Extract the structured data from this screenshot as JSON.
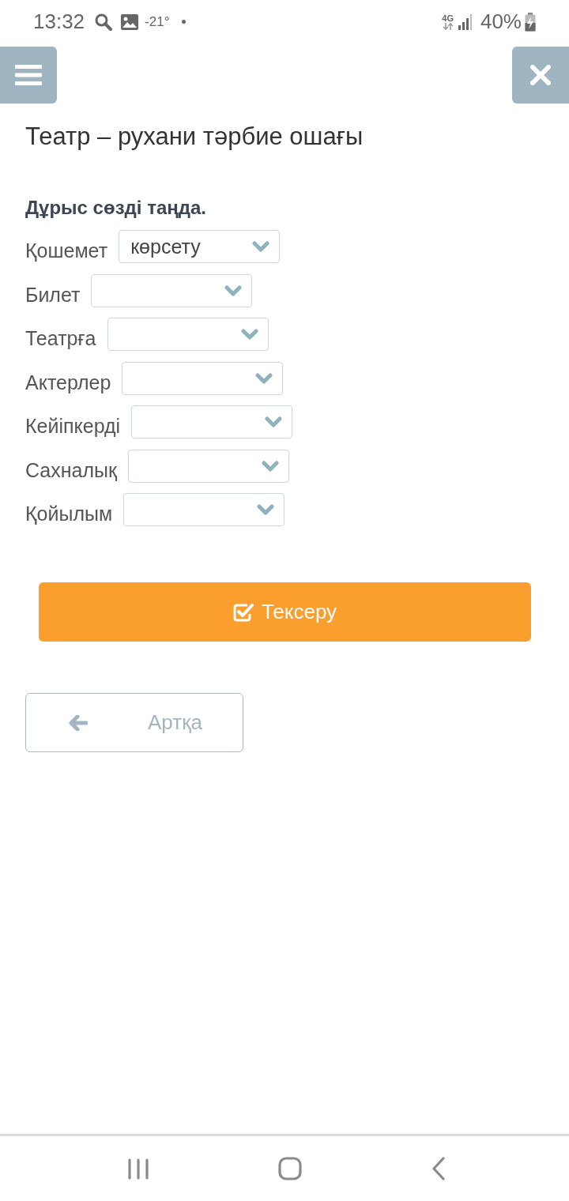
{
  "status_bar": {
    "time": "13:32",
    "temperature": "-21°",
    "network": "4G",
    "battery": "40%"
  },
  "title": "Театр – рухани тәрбие ошағы",
  "exercise": {
    "instruction": "Дұрыс сөзді таңда.",
    "items": [
      {
        "label": "Қошемет",
        "value": "көрсету"
      },
      {
        "label": "Билет"
      },
      {
        "label": "Театрға"
      },
      {
        "label": "Актерлер"
      },
      {
        "label": "Кейіпкерді"
      },
      {
        "label": "Сахналық"
      },
      {
        "label": "Қойылым"
      }
    ]
  },
  "check_button": {
    "label": "Тексеру"
  },
  "back_button": {
    "label": "Артқа"
  }
}
